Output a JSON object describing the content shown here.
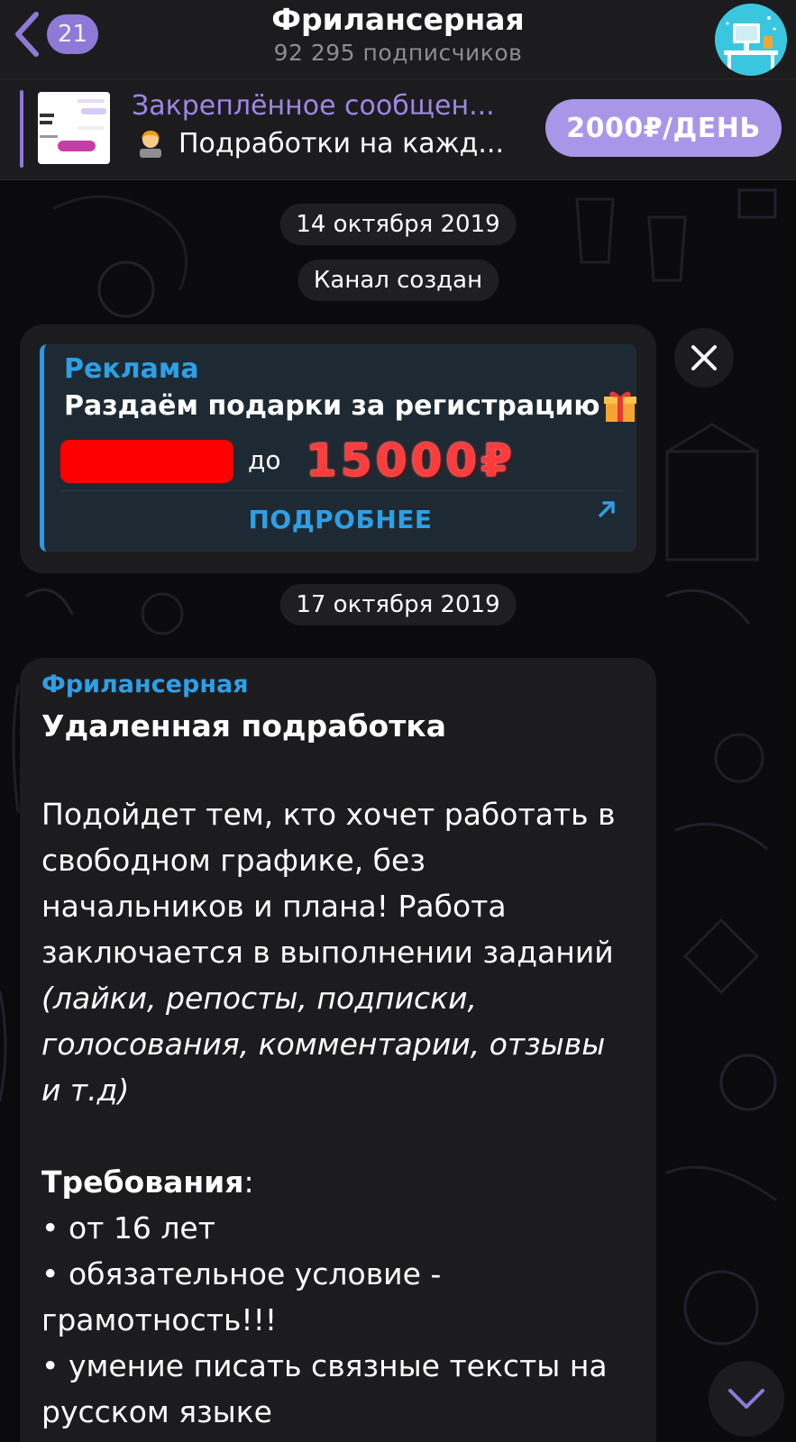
{
  "header": {
    "back_count": "21",
    "title": "Фрилансерная",
    "subtitle": "92 295 подписчиков"
  },
  "pinned": {
    "title": "Закреплённое сообщен...",
    "text": "Подработки на кажд...",
    "button_label": "2000₽/ДЕНЬ"
  },
  "chat": {
    "date_1": "14 октября 2019",
    "service_message": "Канал создан",
    "date_2": "17 октября 2019"
  },
  "ad": {
    "label": "Реклама",
    "title": "Раздаём подарки за регистрацию",
    "prefix": "до",
    "amount": "15000₽",
    "more_label": "ПОДРОБНЕЕ"
  },
  "post": {
    "channel": "Фрилансерная",
    "heading": "Удаленная подработка",
    "lines": [
      "Подойдет тем, кто хочет работать в",
      "свободном графике, без",
      "начальников и плана! Работа",
      "заключается в выполнении заданий",
      "(лайки, репосты, подписки,",
      "голосования, комментарии, отзывы",
      "и т.д)",
      "Требования",
      ":",
      "• от 16 лет",
      "• обязательное условие -",
      "грамотность!!!",
      "• умение писать связные тексты на",
      "русском языке"
    ]
  },
  "colors": {
    "accent_purple": "#8e7ad6",
    "link_blue": "#2e9fe5",
    "bubble_bg": "#1c1c1e",
    "redaction": "#ff0000"
  },
  "icons": [
    "back-chevron-icon",
    "channel-avatar",
    "close-icon",
    "external-link-arrow-icon",
    "gift-icon",
    "chevron-down-icon"
  ]
}
